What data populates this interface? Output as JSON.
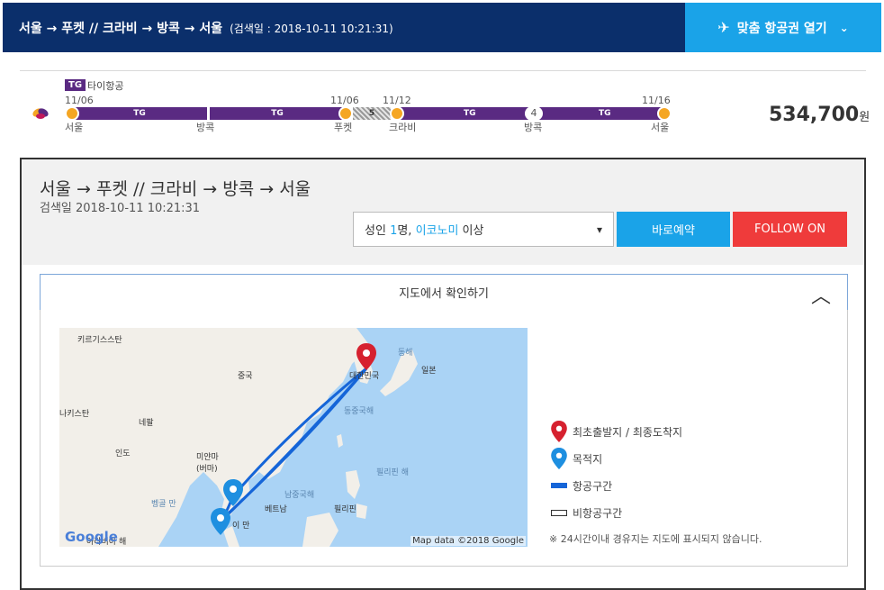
{
  "header": {
    "route": "서울 → 푸켓 // 크라비 → 방콕 → 서울",
    "search_date": "(검색일 : 2018-10-11 10:21:31)",
    "open_button": "맞춤 항공권 열기",
    "plane_icon": "airplane-icon",
    "chevron_icon": "chevron-down-icon"
  },
  "itinerary": {
    "airline_code": "TG",
    "airline_name": "타이항공",
    "leg1": {
      "dep_date": "11/06",
      "arr_date": "11/06",
      "dep_city": "서울",
      "via_city": "방콕",
      "arr_city": "푸켓",
      "seg1": "TG",
      "seg2": "TG"
    },
    "gap": {
      "label": "5"
    },
    "leg2": {
      "dep_date": "11/12",
      "arr_date": "11/16",
      "dep_city": "크라비",
      "via_city": "방콕",
      "arr_city": "서울",
      "seg1": "TG",
      "stop_count": "4",
      "seg2": "TG"
    },
    "price": "534,700",
    "currency": "원"
  },
  "detail": {
    "title": "서울 → 푸켓 // 크라비 → 방콕 → 서울",
    "search_date": "검색일 2018-10-11 10:21:31",
    "pax": {
      "prefix": "성인 ",
      "count": "1",
      "unit": "명, ",
      "cabin": "이코노미",
      "suffix": " 이상"
    },
    "book_button": "바로예약",
    "follow_button": "FOLLOW ON",
    "map_toggle": "지도에서 확인하기"
  },
  "map": {
    "labels": {
      "kyrgyzstan": "키르기스스탄",
      "china": "중국",
      "korea": "대한민국",
      "east_sea": "동해",
      "japan": "일본",
      "afghanistan": "나키스탄",
      "nepal": "네팔",
      "east_china_sea": "동중국해",
      "india": "인도",
      "myanmar": "미얀마\n(버마)",
      "philippine_sea": "필리핀 해",
      "bay_of_bengal": "벵골 만",
      "south_china_sea": "남중국해",
      "vietnam": "베트남",
      "philippines": "필리핀",
      "gulf": "이 만",
      "arabian": "아라비아 해"
    },
    "google_logo": "Google",
    "attribution": "Map data ©2018 Google"
  },
  "legend": {
    "origin": "최초출발지 / 최종도착지",
    "destination": "목적지",
    "flight": "항공구간",
    "non_flight": "비항공구간",
    "note": "※ 24시간이내 경유지는 지도에 표시되지 않습니다."
  },
  "colors": {
    "header_bg": "#0b2f6b",
    "accent_blue": "#1aa3e8",
    "follow_red": "#ef3b3b",
    "airline_purple": "#5a2a82",
    "stop_orange": "#f5a623",
    "route_blue": "#1565d8",
    "origin_red": "#d6212f"
  }
}
